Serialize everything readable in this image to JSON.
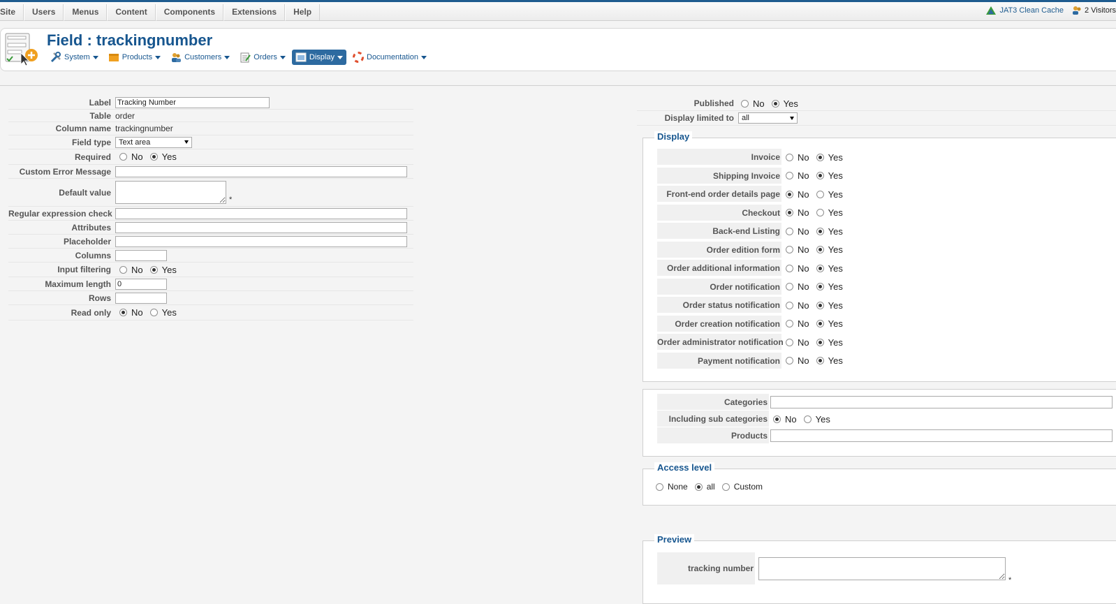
{
  "topbar": {
    "menu": [
      "Site",
      "Users",
      "Menus",
      "Content",
      "Components",
      "Extensions",
      "Help"
    ],
    "cache_label": "JAT3 Clean Cache",
    "visitors_label": "2 Visitors"
  },
  "header": {
    "title": "Field : trackingnumber",
    "toolbar": [
      {
        "label": "System",
        "icon": "tools-icon"
      },
      {
        "label": "Products",
        "icon": "box-icon"
      },
      {
        "label": "Customers",
        "icon": "users-icon"
      },
      {
        "label": "Orders",
        "icon": "orders-icon"
      },
      {
        "label": "Display",
        "icon": "display-icon",
        "active": true
      },
      {
        "label": "Documentation",
        "icon": "lifebuoy-icon"
      }
    ]
  },
  "left": {
    "label": {
      "label": "Label",
      "value": "Tracking Number"
    },
    "table": {
      "label": "Table",
      "value": "order"
    },
    "column": {
      "label": "Column name",
      "value": "trackingnumber"
    },
    "field_type": {
      "label": "Field type",
      "value": "Text area"
    },
    "required": {
      "label": "Required",
      "no": "No",
      "yes": "Yes",
      "selected": "yes"
    },
    "custom_error": {
      "label": "Custom Error Message",
      "value": ""
    },
    "default_value": {
      "label": "Default value",
      "value": "",
      "star": "*"
    },
    "regex": {
      "label": "Regular expression check",
      "value": ""
    },
    "attributes": {
      "label": "Attributes",
      "value": ""
    },
    "placeholder": {
      "label": "Placeholder",
      "value": ""
    },
    "columns": {
      "label": "Columns",
      "value": ""
    },
    "input_filtering": {
      "label": "Input filtering",
      "no": "No",
      "yes": "Yes",
      "selected": "yes"
    },
    "max_length": {
      "label": "Maximum length",
      "value": "0"
    },
    "rows": {
      "label": "Rows",
      "value": ""
    },
    "read_only": {
      "label": "Read only",
      "no": "No",
      "yes": "Yes",
      "selected": "no"
    }
  },
  "right": {
    "published": {
      "label": "Published",
      "no": "No",
      "yes": "Yes",
      "selected": "yes"
    },
    "display_limited": {
      "label": "Display limited to",
      "value": "all"
    },
    "display": {
      "legend": "Display",
      "no": "No",
      "yes": "Yes",
      "rows": [
        {
          "label": "Invoice",
          "selected": "yes"
        },
        {
          "label": "Shipping Invoice",
          "selected": "yes"
        },
        {
          "label": "Front-end order details page",
          "selected": "no"
        },
        {
          "label": "Checkout",
          "selected": "no"
        },
        {
          "label": "Back-end Listing",
          "selected": "yes"
        },
        {
          "label": "Order edition form",
          "selected": "yes"
        },
        {
          "label": "Order additional information",
          "selected": "yes"
        },
        {
          "label": "Order notification",
          "selected": "yes"
        },
        {
          "label": "Order status notification",
          "selected": "yes"
        },
        {
          "label": "Order creation notification",
          "selected": "yes"
        },
        {
          "label": "Order administrator notification",
          "selected": "yes"
        },
        {
          "label": "Payment notification",
          "selected": "yes"
        }
      ]
    },
    "categories": {
      "label": "Categories",
      "value": ""
    },
    "sub_categories": {
      "label": "Including sub categories",
      "no": "No",
      "yes": "Yes",
      "selected": "no"
    },
    "products": {
      "label": "Products",
      "value": ""
    },
    "access": {
      "legend": "Access level",
      "none": "None",
      "all": "all",
      "custom": "Custom",
      "selected": "all"
    },
    "preview": {
      "legend": "Preview",
      "label": "tracking number",
      "value": "",
      "star": "*"
    }
  }
}
